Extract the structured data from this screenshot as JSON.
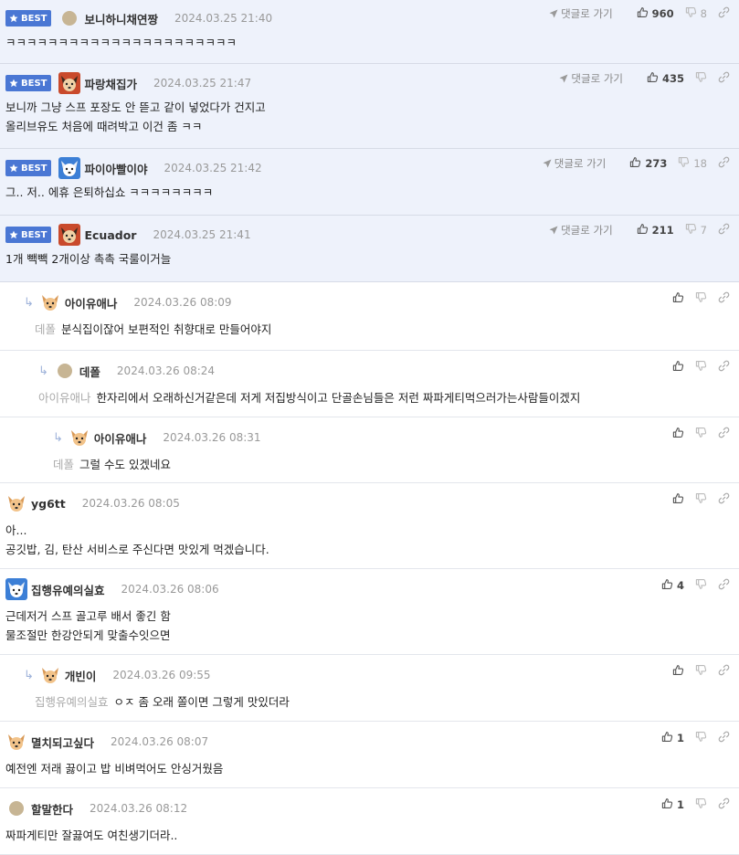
{
  "colors": {
    "best_bg": "#eef2fb",
    "badge": "#4a77d4",
    "divider": "#e3e6ec"
  },
  "labels": {
    "best": "BEST",
    "goto": "댓글로 가기"
  },
  "comments": [
    {
      "best": true,
      "nick": "보니하니채연짱",
      "avatar": "dot",
      "date": "2024.03.25 21:40",
      "likes": "960",
      "dislikes": "8",
      "lines": [
        "ㅋㅋㅋㅋㅋㅋㅋㅋㅋㅋㅋㅋㅋㅋㅋㅋㅋㅋㅋㅋㅋㅋ"
      ]
    },
    {
      "best": true,
      "nick": "파랑채집가",
      "avatar": "dog-red",
      "date": "2024.03.25 21:47",
      "likes": "435",
      "dislikes": "",
      "lines": [
        "보니까 그냥 스프 포장도 안 뜯고 같이 넣었다가 건지고",
        "올리브유도 처음에 때려박고 이건 좀 ㅋㅋ"
      ]
    },
    {
      "best": true,
      "nick": "파이아빨이야",
      "avatar": "dog-blue",
      "date": "2024.03.25 21:42",
      "likes": "273",
      "dislikes": "18",
      "lines": [
        "그.. 저.. 에휴 은퇴하십쇼 ㅋㅋㅋㅋㅋㅋㅋㅋ"
      ]
    },
    {
      "best": true,
      "nick": "Ecuador",
      "avatar": "dog-red",
      "date": "2024.03.25 21:41",
      "likes": "211",
      "dislikes": "7",
      "lines": [
        "1개 빽빽 2개이상 촉촉 국룰이거늘"
      ]
    },
    {
      "best": false,
      "depth": 1,
      "nick": "아이유애나",
      "avatar": "dog",
      "date": "2024.03.26 08:09",
      "likes": "",
      "mention": "데폴",
      "lines": [
        "분식집이잖어 보편적인 취향대로 만들어야지"
      ]
    },
    {
      "best": false,
      "depth": 2,
      "nick": "데폴",
      "avatar": "dot",
      "date": "2024.03.26 08:24",
      "likes": "",
      "mention": "아이유애나",
      "lines": [
        "한자리에서 오래하신거같은데 저게 저집방식이고 단골손님들은 저런 짜파게티먹으러가는사람들이겠지"
      ]
    },
    {
      "best": false,
      "depth": 3,
      "nick": "아이유애나",
      "avatar": "dog",
      "date": "2024.03.26 08:31",
      "likes": "",
      "mention": "데폴",
      "lines": [
        "그럴 수도 있겠네요"
      ]
    },
    {
      "best": false,
      "depth": 0,
      "nick": "yg6tt",
      "avatar": "dog",
      "date": "2024.03.26 08:05",
      "likes": "",
      "lines": [
        "아...",
        "공깃밥, 김, 탄산 서비스로 주신다면 맛있게 먹겠습니다."
      ]
    },
    {
      "best": false,
      "depth": 0,
      "nick": "집행유예의실효",
      "avatar": "dog-blue",
      "date": "2024.03.26 08:06",
      "likes": "4",
      "lines": [
        "근데저거 스프 골고루 배서 좋긴 함",
        "물조절만 한강안되게 맞출수잇으면"
      ]
    },
    {
      "best": false,
      "depth": 1,
      "nick": "개빈이",
      "avatar": "dog",
      "date": "2024.03.26 09:55",
      "likes": "",
      "mention": "집행유예의실효",
      "lines": [
        "ㅇㅈ 좀 오래 쫄이면 그렇게 맛있더라"
      ]
    },
    {
      "best": false,
      "depth": 0,
      "nick": "멸치되고싶다",
      "avatar": "dog",
      "date": "2024.03.26 08:07",
      "likes": "1",
      "lines": [
        "예전엔 저래 끓이고 밥 비벼먹어도 안싱거웠음"
      ]
    },
    {
      "best": false,
      "depth": 0,
      "nick": "할말한다",
      "avatar": "dot",
      "date": "2024.03.26 08:12",
      "likes": "1",
      "lines": [
        "짜파게티만 잘끓여도 여친생기더라.."
      ]
    }
  ]
}
